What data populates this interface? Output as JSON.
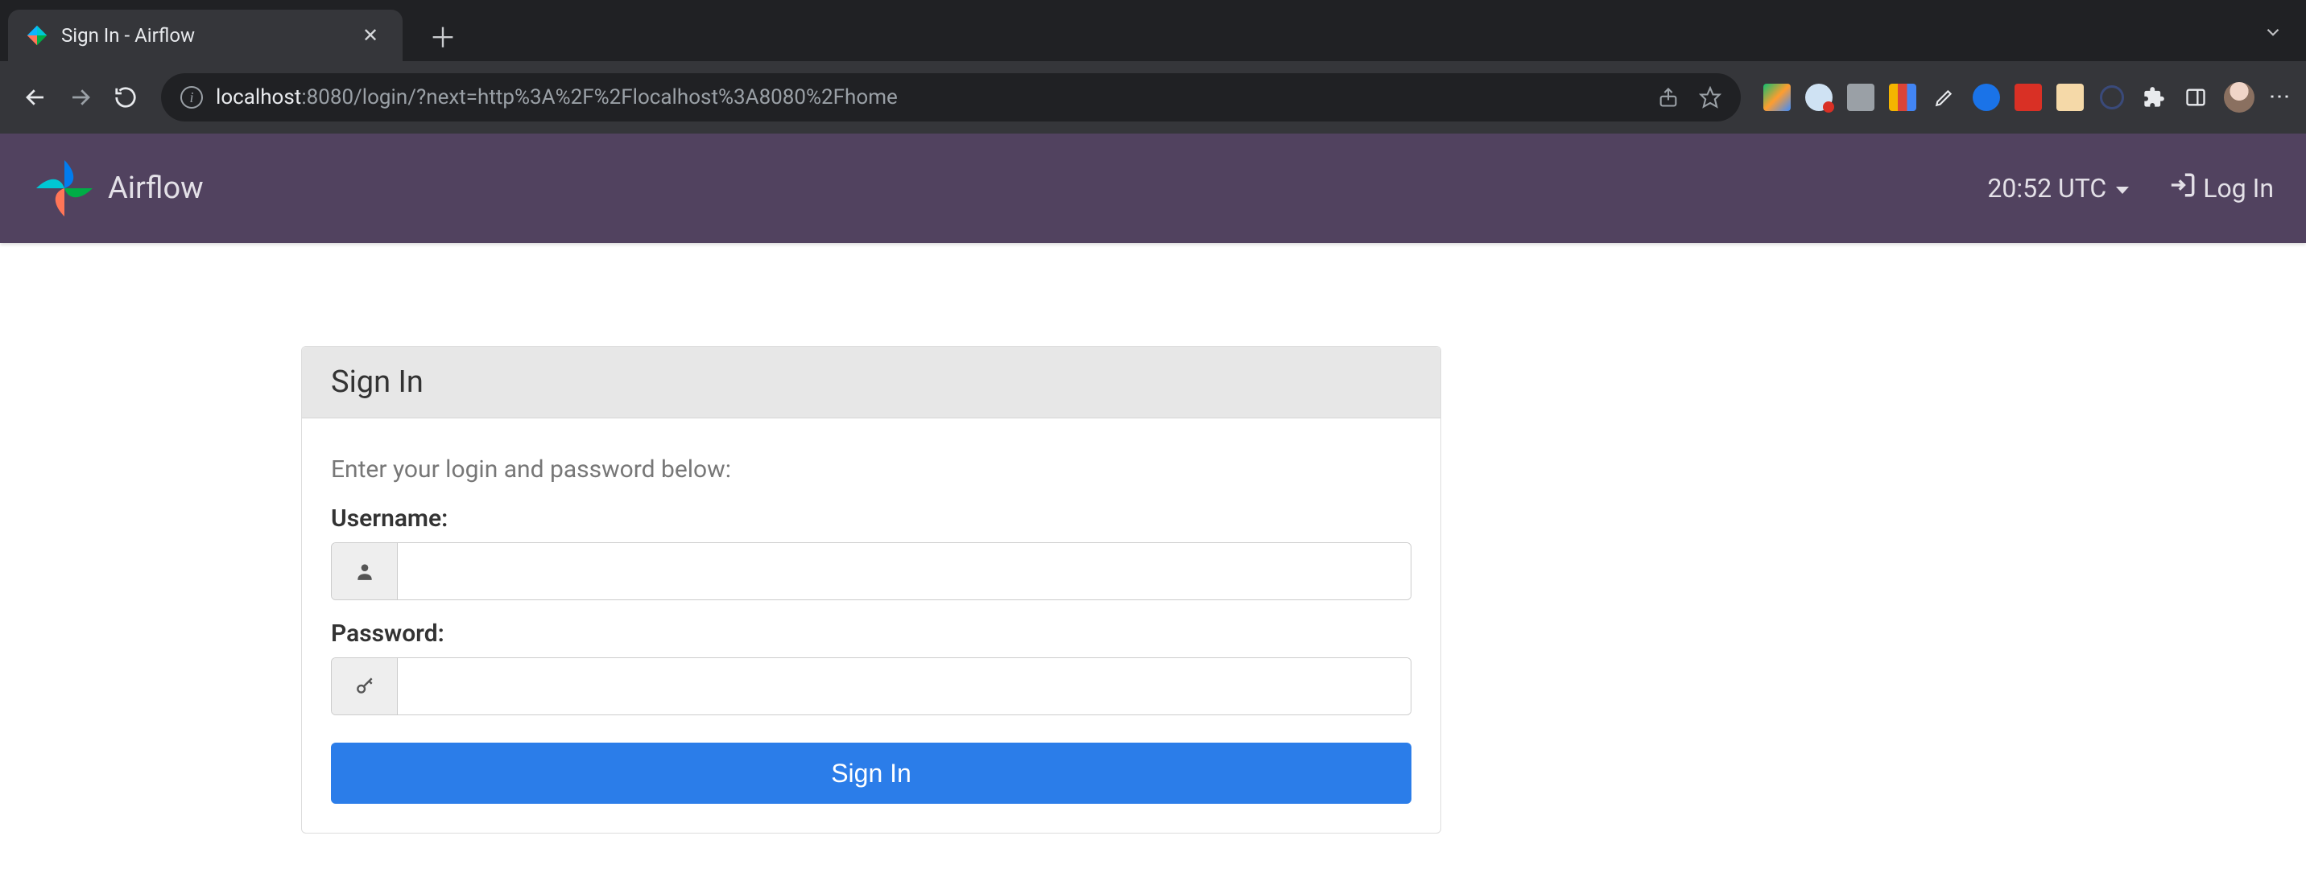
{
  "browser": {
    "tab_title": "Sign In - Airflow",
    "url_host": "localhost",
    "url_rest": ":8080/login/?next=http%3A%2F%2Flocalhost%3A8080%2Fhome"
  },
  "navbar": {
    "brand": "Airflow",
    "clock": "20:52 UTC",
    "login_label": "Log In"
  },
  "signin": {
    "panel_title": "Sign In",
    "instructions": "Enter your login and password below:",
    "username_label": "Username:",
    "username_value": "",
    "password_label": "Password:",
    "password_value": "",
    "submit_label": "Sign In"
  }
}
